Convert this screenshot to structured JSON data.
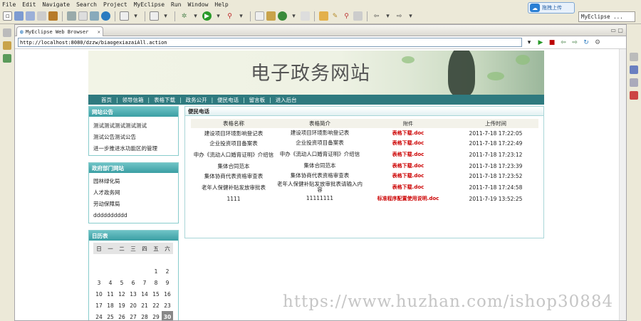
{
  "menu": [
    "File",
    "Edit",
    "Navigate",
    "Search",
    "Project",
    "MyEclipse",
    "Run",
    "Window",
    "Help"
  ],
  "toolbar": {
    "upload_label": "拖拽上传",
    "perspective_label": "MyEclipse ..."
  },
  "browser": {
    "tab_title": "MyEclipse Web Browser",
    "url": "http://localhost:8080/dzzw/biaogexiazaiAll.action"
  },
  "site": {
    "title": "电子政务网站",
    "nav": [
      "首页",
      "领导信箱",
      "表格下载",
      "政务公开",
      "便民电话",
      "留言板",
      "进入后台"
    ],
    "notice": {
      "heading": "网站公告",
      "items": [
        "测试测试测试测试测试",
        "测试公告测试公告",
        "进一步推进水功能区的管理"
      ]
    },
    "links": {
      "heading": "政府部门网站",
      "items": [
        "园林绿化局",
        "人才政务网",
        "劳动保障局",
        "dddddddddd"
      ]
    },
    "calendar": {
      "heading": "日历表",
      "weekdays": [
        "日",
        "一",
        "二",
        "三",
        "四",
        "五",
        "六"
      ],
      "weeks": [
        [
          "",
          "",
          "",
          "",
          "",
          "",
          ""
        ],
        [
          "",
          "",
          "",
          "",
          "",
          "1",
          "2"
        ],
        [
          "3",
          "4",
          "5",
          "6",
          "7",
          "8",
          "9"
        ],
        [
          "10",
          "11",
          "12",
          "13",
          "14",
          "15",
          "16"
        ],
        [
          "17",
          "18",
          "19",
          "20",
          "21",
          "22",
          "23"
        ],
        [
          "24",
          "25",
          "26",
          "27",
          "28",
          "29",
          "30"
        ]
      ],
      "today": "30"
    },
    "main": {
      "heading": "便民电话",
      "columns": [
        "表格名称",
        "表格简介",
        "附件",
        "上传时间"
      ],
      "rows": [
        {
          "name": "建设项目环境影响登记表",
          "intro": "建设项目环境影响登记表",
          "file": "表格下载.doc",
          "time": "2011-7-18 17:22:05"
        },
        {
          "name": "企业投资项目备案表",
          "intro": "企业投资项目备案表",
          "file": "表格下载.doc",
          "time": "2011-7-18 17:22:49"
        },
        {
          "name": "申办《流动人口婚育证明》介绍信",
          "intro": "申办《流动人口婚育证明》介绍信",
          "file": "表格下载.doc",
          "time": "2011-7-18 17:23:12"
        },
        {
          "name": "集体合同范本",
          "intro": "集体合同范本",
          "file": "表格下载.doc",
          "time": "2011-7-18 17:23:39"
        },
        {
          "name": "集体协商代表资格审查表",
          "intro": "集体协商代表资格审查表",
          "file": "表格下载.doc",
          "time": "2011-7-18 17:23:52"
        },
        {
          "name": "老年人保健补贴发放审批表",
          "intro": "老年人保健补贴发放审批表请输入内容",
          "file": "表格下载.doc",
          "time": "2011-7-18 17:24:58"
        },
        {
          "name": "1111",
          "intro": "11111111",
          "file": "标准程序配置使用说明.doc",
          "time": "2011-7-19 13:52:25"
        }
      ]
    }
  },
  "watermark": "https://www.huzhan.com/ishop30884"
}
